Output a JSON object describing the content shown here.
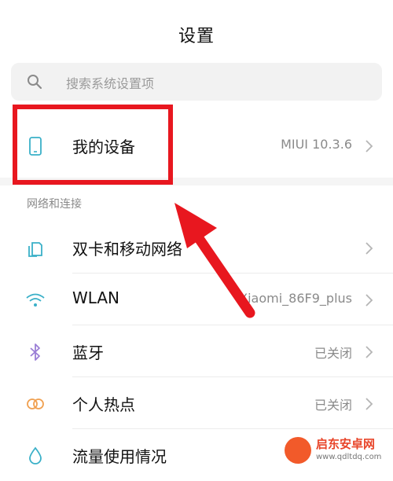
{
  "header": {
    "title": "设置"
  },
  "search": {
    "placeholder": "搜索系统设置项"
  },
  "device_row": {
    "label": "我的设备",
    "value": "MIUI 10.3.6",
    "icon": "phone-icon"
  },
  "section": {
    "header": "网络和连接"
  },
  "network_rows": [
    {
      "label": "双卡和移动网络",
      "value": "",
      "icon": "sim-card-icon"
    },
    {
      "label": "WLAN",
      "value": "Xiaomi_86F9_plus",
      "icon": "wifi-icon"
    },
    {
      "label": "蓝牙",
      "value": "已关闭",
      "icon": "bluetooth-icon"
    },
    {
      "label": "个人热点",
      "value": "已关闭",
      "icon": "hotspot-icon"
    },
    {
      "label": "流量使用情况",
      "value": "",
      "icon": "data-usage-icon"
    }
  ],
  "watermark": {
    "name": "启东安卓网",
    "url": "www.qdltdq.com"
  },
  "colors": {
    "accent_icon": "#3ab0c8",
    "bluetooth_icon": "#9b7fd6",
    "hotspot_icon": "#f0a050",
    "annotation_red": "#e8171f"
  }
}
